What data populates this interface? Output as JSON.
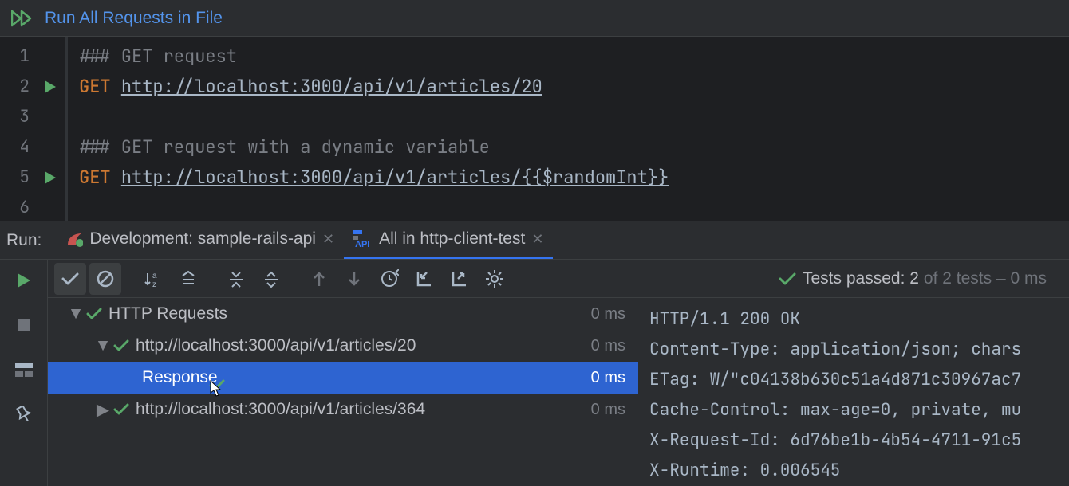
{
  "run_bar": {
    "label": "Run All Requests in File"
  },
  "editor": {
    "lines": [
      {
        "num": "1",
        "parts": [
          {
            "cls": "tok-comment",
            "text": "### GET request"
          }
        ],
        "run": false
      },
      {
        "num": "2",
        "parts": [
          {
            "cls": "tok-method",
            "text": "GET"
          },
          {
            "cls": "",
            "text": " "
          },
          {
            "cls": "tok-url",
            "text": "http://localhost:3000/api/v1/articles/20"
          }
        ],
        "run": true
      },
      {
        "num": "3",
        "parts": [],
        "run": false
      },
      {
        "num": "4",
        "parts": [
          {
            "cls": "tok-comment",
            "text": "### GET request with a dynamic variable"
          }
        ],
        "run": false
      },
      {
        "num": "5",
        "parts": [
          {
            "cls": "tok-method",
            "text": "GET"
          },
          {
            "cls": "",
            "text": " "
          },
          {
            "cls": "tok-url",
            "text": "http://localhost:3000/api/v1/articles/{{$randomInt}}"
          }
        ],
        "run": true
      },
      {
        "num": "6",
        "parts": [],
        "run": false
      }
    ]
  },
  "run_header": {
    "label": "Run:",
    "tabs": [
      {
        "name": "Development: sample-rails-api",
        "active": false,
        "icon": "rails"
      },
      {
        "name": "All in http-client-test",
        "active": true,
        "icon": "api"
      }
    ]
  },
  "summary": {
    "prefix": "Tests passed: ",
    "count": "2",
    "suffix": "of 2 tests – 0 ms"
  },
  "tree": [
    {
      "depth": 1,
      "arrow": "down",
      "label": "HTTP Requests",
      "time": "0 ms",
      "selected": false
    },
    {
      "depth": 2,
      "arrow": "down",
      "label": "http://localhost:3000/api/v1/articles/20",
      "time": "0 ms",
      "selected": false
    },
    {
      "depth": 3,
      "arrow": "",
      "label": "Response",
      "time": "0 ms",
      "selected": true
    },
    {
      "depth": 2,
      "arrow": "right",
      "label": "http://localhost:3000/api/v1/articles/364",
      "time": "0 ms",
      "selected": false
    }
  ],
  "response": [
    "HTTP/1.1 200 OK",
    "Content-Type: application/json; chars",
    "ETag: W/\"c04138b630c51a4d871c30967ac7",
    "Cache-Control: max-age=0, private, mu",
    "X-Request-Id: 6d76be1b-4b54-4711-91c5",
    "X-Runtime: 0.006545"
  ]
}
